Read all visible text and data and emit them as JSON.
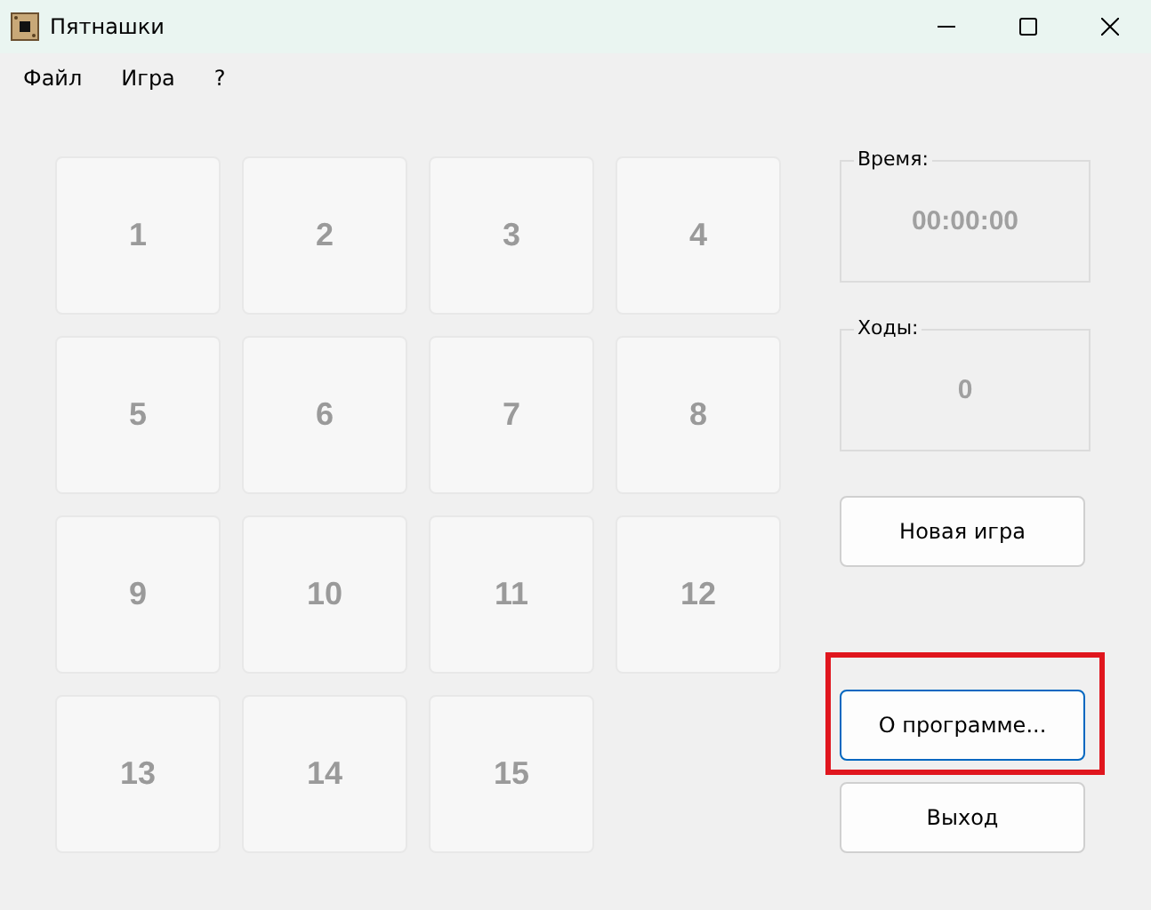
{
  "window": {
    "title": "Пятнашки"
  },
  "menu": [
    {
      "label": "Файл"
    },
    {
      "label": "Игра"
    },
    {
      "label": "?"
    }
  ],
  "tiles": [
    {
      "label": "1"
    },
    {
      "label": "2"
    },
    {
      "label": "3"
    },
    {
      "label": "4"
    },
    {
      "label": "5"
    },
    {
      "label": "6"
    },
    {
      "label": "7"
    },
    {
      "label": "8"
    },
    {
      "label": "9"
    },
    {
      "label": "10"
    },
    {
      "label": "11"
    },
    {
      "label": "12"
    },
    {
      "label": "13"
    },
    {
      "label": "14"
    },
    {
      "label": "15"
    }
  ],
  "groups": [
    {
      "title": "Время:",
      "value": "00:00:00"
    },
    {
      "title": "Ходы:",
      "value": "0"
    }
  ],
  "buttons": [
    {
      "label": "Новая игра",
      "focused": false,
      "highlighted": false
    },
    {
      "label": "О программе...",
      "focused": true,
      "highlighted": true
    },
    {
      "label": "Выход",
      "focused": false,
      "highlighted": false
    }
  ]
}
